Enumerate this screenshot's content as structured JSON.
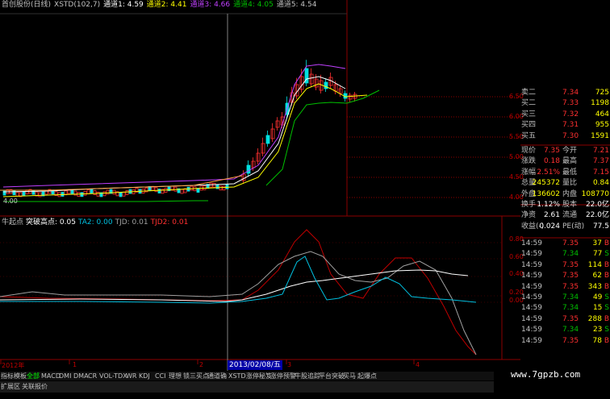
{
  "main_title": {
    "name": "首创股份(日线)",
    "indicator": "XSTD(102,7)",
    "ch1": "通道1: 4.59",
    "ch2": "通道2: 4.41",
    "ch3": "通道3: 4.66",
    "ch4": "通道4: 4.05",
    "ch5": "通道5: 4.54"
  },
  "sub_title": {
    "name": "牛起点",
    "breakout": "突破高点: 0.05",
    "ta2": "TA2: 0.00",
    "tjd": "TJD: 0.01",
    "tjd2": "TJD2: 0.01"
  },
  "price_axis": [
    "6.50",
    "6.00",
    "5.50",
    "5.00",
    "4.50",
    "4.00"
  ],
  "sub_axis": [
    "0.80",
    "0.60",
    "0.40",
    "0.20",
    "0.00"
  ],
  "low_marker": "4.00",
  "x_axis": [
    "2012年",
    "1",
    "2",
    "3",
    "4"
  ],
  "cursor_date": "2013/02/08/五",
  "quotes": {
    "sell": [
      {
        "label": "卖二",
        "price": "7.34",
        "vol": "725"
      },
      {
        "label": "买二",
        "price": "7.33",
        "vol": "1198"
      },
      {
        "label": "买三",
        "price": "7.32",
        "vol": "464"
      },
      {
        "label": "买四",
        "price": "7.31",
        "vol": "955"
      },
      {
        "label": "买五",
        "price": "7.30",
        "vol": "1591"
      }
    ],
    "stats": [
      {
        "l1": "现价",
        "v1": "7.35",
        "l2": "今开",
        "v2": "7.21"
      },
      {
        "l1": "涨跌",
        "v1": "0.18",
        "l2": "最高",
        "v2": "7.37"
      },
      {
        "l1": "涨幅",
        "v1": "2.51%",
        "l2": "最低",
        "v2": "7.15"
      },
      {
        "l1": "总量",
        "v1": "245372",
        "l2": "量比",
        "v2": "0.84"
      },
      {
        "l1": "外盘",
        "v1": "136602",
        "l2": "内盘",
        "v2": "108770"
      },
      {
        "l1": "换手",
        "v1": "1.12%",
        "l2": "股本",
        "v2": "22.0亿"
      },
      {
        "l1": "净资",
        "v1": "2.61",
        "l2": "流通",
        "v2": "22.0亿"
      },
      {
        "l1": "收益(-)",
        "v1": "0.024",
        "l2": "PE(动)",
        "v2": "77.5"
      }
    ],
    "ticks": [
      {
        "time": "14:59",
        "price": "7.35",
        "vol": "37",
        "side": "B"
      },
      {
        "time": "14:59",
        "price": "7.34",
        "vol": "77",
        "side": "S"
      },
      {
        "time": "14:59",
        "price": "7.35",
        "vol": "114",
        "side": "B"
      },
      {
        "time": "14:59",
        "price": "7.35",
        "vol": "62",
        "side": "B"
      },
      {
        "time": "14:59",
        "price": "7.35",
        "vol": "343",
        "side": "B"
      },
      {
        "time": "14:59",
        "price": "7.34",
        "vol": "49",
        "side": "S"
      },
      {
        "time": "14:59",
        "price": "7.34",
        "vol": "15",
        "side": "S"
      },
      {
        "time": "14:59",
        "price": "7.35",
        "vol": "288",
        "side": "B"
      },
      {
        "time": "14:59",
        "price": "7.34",
        "vol": "23",
        "side": "S"
      },
      {
        "time": "14:59",
        "price": "7.35",
        "vol": "78",
        "side": "B"
      }
    ]
  },
  "tabs_row1": [
    "指标",
    "模板",
    "全部",
    "MACD",
    "DMI",
    "DMA",
    "CR",
    "VOL-TDX",
    "WR",
    "KDJ",
    "CCI",
    "理想",
    "锁三买点",
    "通道确",
    "XSTD",
    "涨停秘笈",
    "涨停预警",
    "牛股追踪",
    "平台突破",
    "买马",
    "起爆点"
  ],
  "tabs_row2": [
    "扩展区",
    "关联报价"
  ],
  "watermark": "www.7gpzb.com",
  "colors": {
    "up": "#ff3030",
    "down": "#00e0e0",
    "grid": "#8b0000",
    "ch_purple": "#c040ff",
    "ch_green": "#00c000",
    "ch_yellow": "#ffff00",
    "ch_white": "#ffffff"
  }
}
